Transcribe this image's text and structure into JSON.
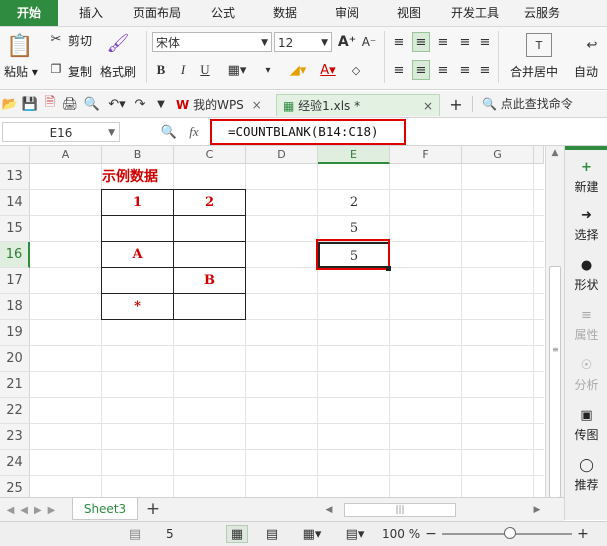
{
  "ribbon_tabs": [
    "开始",
    "插入",
    "页面布局",
    "公式",
    "数据",
    "审阅",
    "视图",
    "开发工具",
    "云服务"
  ],
  "ribbon": {
    "paste": "粘贴",
    "cut": "剪切",
    "copy": "复制",
    "format_painter": "格式刷",
    "font_name": "宋体",
    "font_size": "12",
    "merge_center": "合并居中",
    "auto_wrap": "自动"
  },
  "doc_tabs": {
    "wps": "我的WPS",
    "file": "经验1.xls *",
    "search_cmd": "点此查找命令"
  },
  "formula_bar": {
    "cell_ref": "E16",
    "fx": "fx",
    "formula": "=COUNTBLANK(B14:C18)"
  },
  "columns": [
    "A",
    "B",
    "C",
    "D",
    "E",
    "F",
    "G"
  ],
  "rows": [
    "13",
    "14",
    "15",
    "16",
    "17",
    "18",
    "19",
    "20",
    "21",
    "22",
    "23",
    "24",
    "25"
  ],
  "cells": {
    "title": "示例数据",
    "b14": "1",
    "c14": "2",
    "b16": "A",
    "c17": "B",
    "b18": "*",
    "e14": "2",
    "e15": "5",
    "e16": "5"
  },
  "right_panel": [
    "新建",
    "选择",
    "形状",
    "属性",
    "分析",
    "传图",
    "推荐"
  ],
  "sheet_tab": "Sheet3",
  "status": {
    "count": "5",
    "zoom": "100 %"
  },
  "colors": {
    "accent": "#2e8b3f",
    "highlight_box": "#e00000",
    "data_red": "#d10000"
  }
}
